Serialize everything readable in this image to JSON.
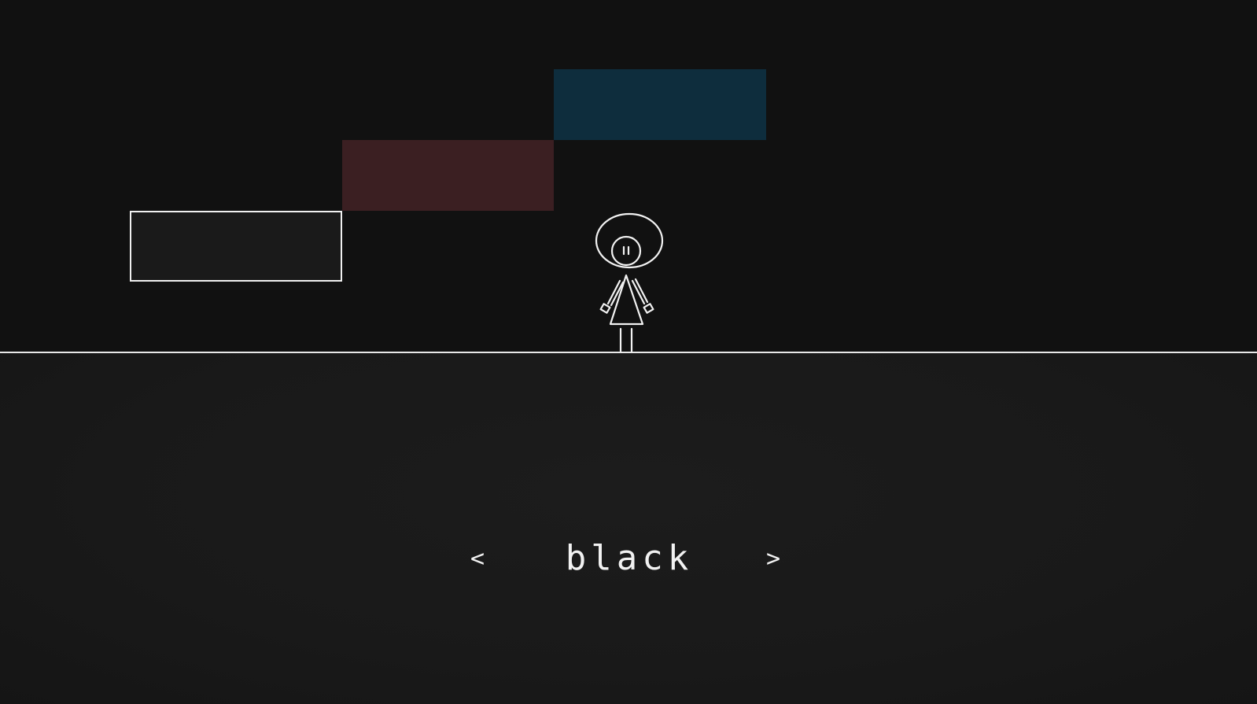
{
  "colors": {
    "background": "#111111",
    "ground": "#1a1a1a",
    "outline": "#f0f0f0",
    "block_black": "#1a1a1a",
    "block_red": "#3b1f22",
    "block_blue": "#0e2d3d"
  },
  "blocks": [
    {
      "color_name": "black",
      "fill": "#1a1a1a",
      "outlined": true
    },
    {
      "color_name": "red",
      "fill": "#3b1f22",
      "outlined": false
    },
    {
      "color_name": "blue",
      "fill": "#0e2d3d",
      "outlined": false
    }
  ],
  "selector": {
    "prev_label": "<",
    "current_color": "black",
    "next_label": ">"
  },
  "character": {
    "icon": "stick-figure-character-icon"
  }
}
